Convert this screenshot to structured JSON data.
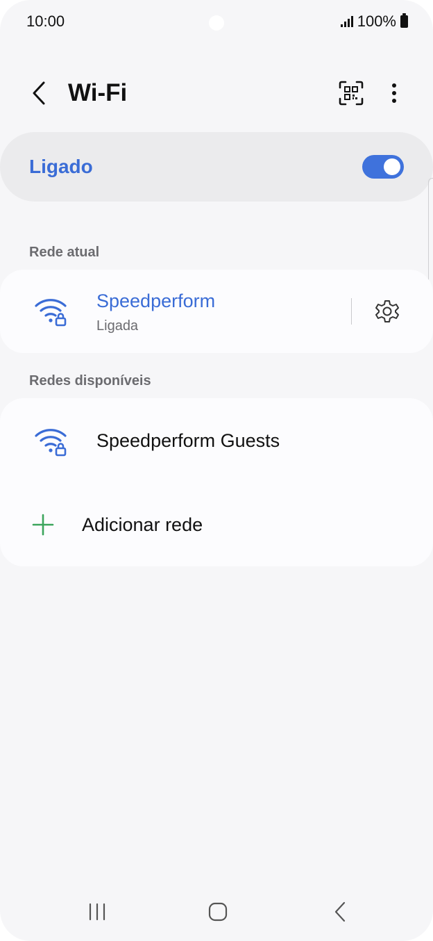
{
  "status_bar": {
    "time": "10:00",
    "battery": "100%"
  },
  "header": {
    "title": "Wi-Fi",
    "back_icon": "chevron-left-icon",
    "qr_icon": "qr-scan-icon",
    "more_icon": "more-vertical-icon"
  },
  "master": {
    "label": "Ligado",
    "on": true,
    "accent": "#3f72dc"
  },
  "current": {
    "section_label": "Rede atual",
    "network": {
      "name": "Speedperform",
      "status": "Ligada",
      "icon": "wifi-lock-icon",
      "settings_icon": "gear-icon"
    }
  },
  "available": {
    "section_label": "Redes disponíveis",
    "networks": [
      {
        "name": "Speedperform Guests",
        "icon": "wifi-lock-icon"
      }
    ],
    "add_label": "Adicionar rede",
    "add_icon": "plus-icon",
    "add_color": "#3ca55c"
  },
  "nav": {
    "recents_icon": "recents-icon",
    "home_icon": "home-icon",
    "back_icon": "back-icon"
  }
}
